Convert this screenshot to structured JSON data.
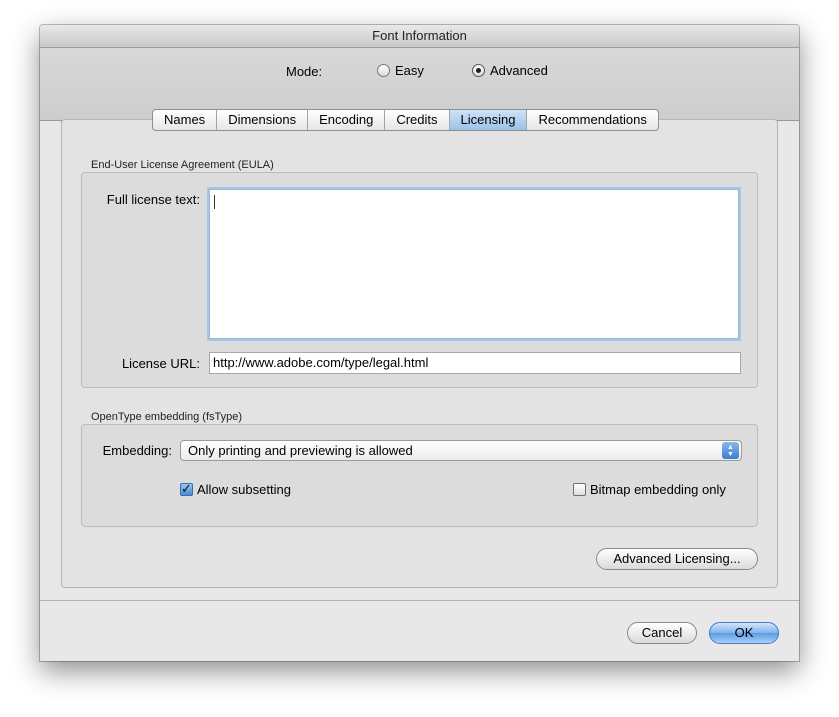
{
  "window": {
    "title": "Font Information"
  },
  "mode": {
    "label": "Mode:",
    "options": [
      {
        "label": "Easy",
        "selected": false
      },
      {
        "label": "Advanced",
        "selected": true
      }
    ]
  },
  "tabs": [
    {
      "label": "Names",
      "active": false
    },
    {
      "label": "Dimensions",
      "active": false
    },
    {
      "label": "Encoding",
      "active": false
    },
    {
      "label": "Credits",
      "active": false
    },
    {
      "label": "Licensing",
      "active": true
    },
    {
      "label": "Recommendations",
      "active": false
    }
  ],
  "eula": {
    "section_title": "End-User License Agreement (EULA)",
    "full_text_label": "Full license text:",
    "full_text_value": "",
    "url_label": "License URL:",
    "url_value": "http://www.adobe.com/type/legal.html"
  },
  "embedding": {
    "section_title": "OpenType embedding (fsType)",
    "label": "Embedding:",
    "selected": "Only printing and previewing is allowed",
    "allow_subsetting_label": "Allow subsetting",
    "allow_subsetting_checked": true,
    "bitmap_only_label": "Bitmap embedding only",
    "bitmap_only_checked": false
  },
  "buttons": {
    "advanced_licensing": "Advanced Licensing...",
    "cancel": "Cancel",
    "ok": "OK"
  },
  "colors": {
    "window_bg": "#e8e8e8",
    "active_tab": "#9bc2ea",
    "default_button": "#5d9be6"
  }
}
